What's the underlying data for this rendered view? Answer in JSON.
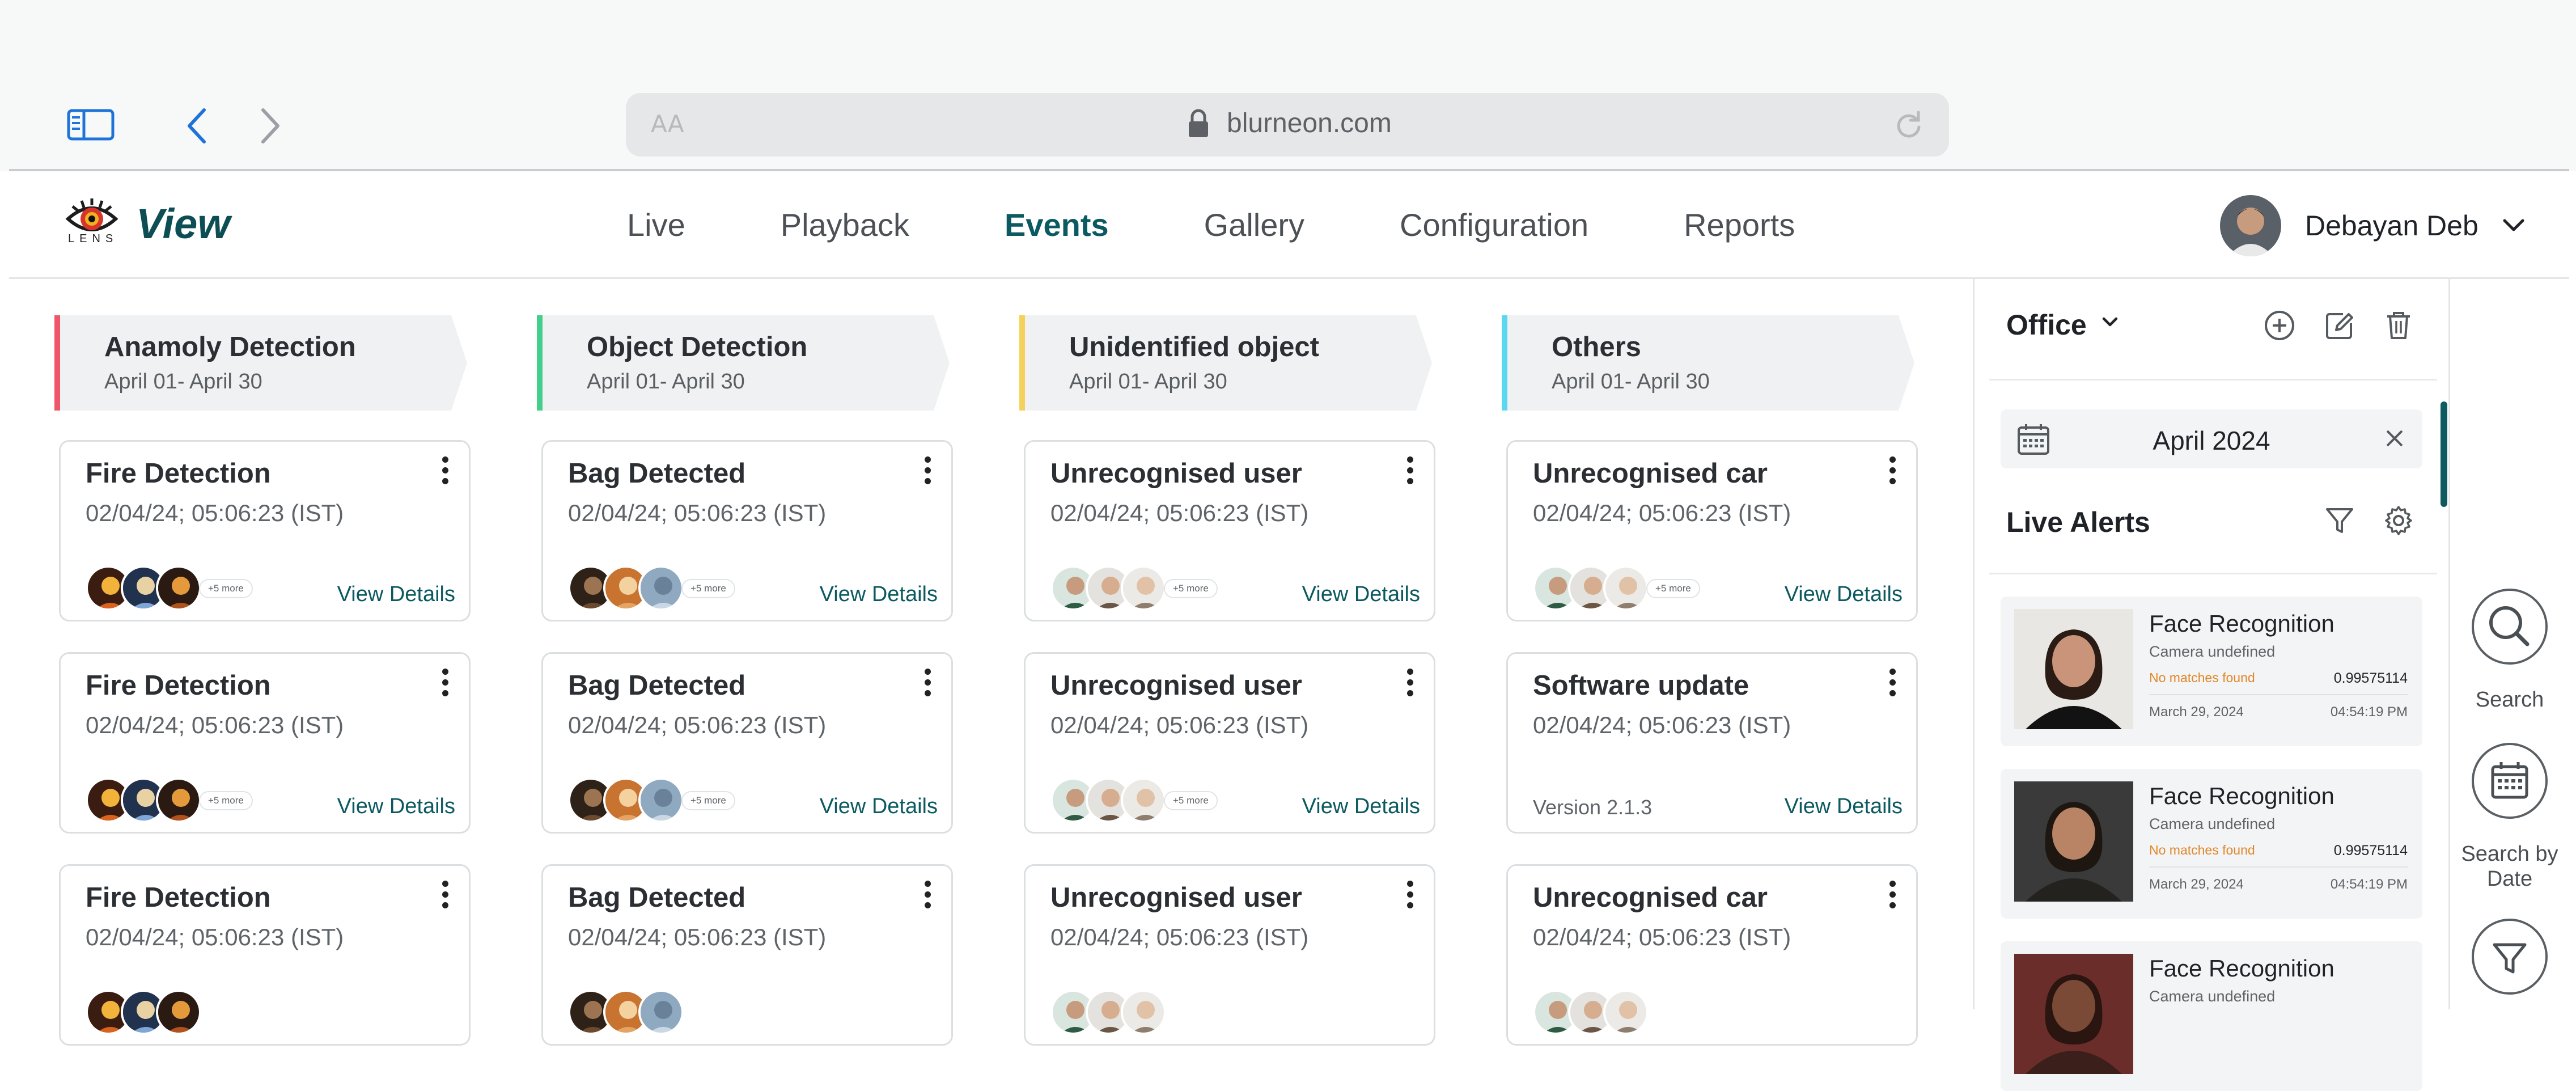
{
  "browser": {
    "url": "blurneon.com",
    "text_size_label": "AA",
    "icons": [
      "sidebar-icon",
      "back-icon",
      "forward-icon",
      "lock-icon",
      "reload-icon"
    ]
  },
  "header": {
    "brand": "View",
    "logo_text": "LENS",
    "nav": [
      "Live",
      "Playback",
      "Events",
      "Gallery",
      "Configuration",
      "Reports"
    ],
    "active_nav": "Events",
    "user_name": "Debayan Deb"
  },
  "columns": [
    {
      "title": "Anamoly Detection",
      "range": "April 01- April 30",
      "accent": "#f0566a",
      "cards": [
        {
          "title": "Fire Detection",
          "time": "02/04/24; 05:06:23 (IST)",
          "thumb_set": "fire",
          "more": "+5 more",
          "link": "View Details"
        },
        {
          "title": "Fire Detection",
          "time": "02/04/24; 05:06:23 (IST)",
          "thumb_set": "fire",
          "more": "+5 more",
          "link": "View Details"
        },
        {
          "title": "Fire Detection",
          "time": "02/04/24; 05:06:23 (IST)",
          "thumb_set": "fire",
          "more": "",
          "link": ""
        }
      ]
    },
    {
      "title": "Object Detection",
      "range": "April 01- April 30",
      "accent": "#43cf8a",
      "cards": [
        {
          "title": "Bag Detected",
          "time": "02/04/24; 05:06:23 (IST)",
          "thumb_set": "bag",
          "more": "+5 more",
          "link": "View Details"
        },
        {
          "title": "Bag Detected",
          "time": "02/04/24; 05:06:23 (IST)",
          "thumb_set": "bag",
          "more": "+5 more",
          "link": "View Details"
        },
        {
          "title": "Bag Detected",
          "time": "02/04/24; 05:06:23 (IST)",
          "thumb_set": "bag",
          "more": "",
          "link": ""
        }
      ]
    },
    {
      "title": "Unidentified object",
      "range": "April 01- April 30",
      "accent": "#f4d25a",
      "cards": [
        {
          "title": "Unrecognised user",
          "time": "02/04/24; 05:06:23 (IST)",
          "thumb_set": "people",
          "more": "+5 more",
          "link": "View Details"
        },
        {
          "title": "Unrecognised user",
          "time": "02/04/24; 05:06:23 (IST)",
          "thumb_set": "people",
          "more": "+5 more",
          "link": "View Details"
        },
        {
          "title": "Unrecognised user",
          "time": "02/04/24; 05:06:23 (IST)",
          "thumb_set": "people",
          "more": "",
          "link": ""
        }
      ]
    },
    {
      "title": "Others",
      "range": "April 01- April 30",
      "accent": "#5ad8f0",
      "cards": [
        {
          "title": "Unrecognised car",
          "time": "02/04/24; 05:06:23 (IST)",
          "thumb_set": "people",
          "more": "+5 more",
          "link": "View Details"
        },
        {
          "title": "Software update",
          "time": "02/04/24; 05:06:23 (IST)",
          "thumb_set": "",
          "more": "",
          "link": "View Details",
          "version": "Version 2.1.3"
        },
        {
          "title": "Unrecognised car",
          "time": "02/04/24; 05:06:23 (IST)",
          "thumb_set": "people",
          "more": "",
          "link": ""
        }
      ]
    }
  ],
  "panel": {
    "location": "Office",
    "date": "April 2024",
    "alerts_title": "Live Alerts",
    "alerts": [
      {
        "title": "Face Recognition",
        "camera": "Camera undefined",
        "status": "No matches found",
        "score": "0.99575114",
        "date": "March 29, 2024",
        "time": "04:54:19 PM",
        "photo": "woman"
      },
      {
        "title": "Face Recognition",
        "camera": "Camera undefined",
        "status": "No matches found",
        "score": "0.99575114",
        "date": "March 29, 2024",
        "time": "04:54:19 PM",
        "photo": "man"
      },
      {
        "title": "Face Recognition",
        "camera": "Camera undefined",
        "status": "",
        "score": "",
        "date": "",
        "time": "",
        "photo": "woman2"
      }
    ]
  },
  "rail": {
    "search_label": "Search",
    "search_date_label": "Search by Date"
  },
  "colors": {
    "brand": "#0d4e55",
    "link": "#0b5961",
    "warning": "#e0882a"
  }
}
